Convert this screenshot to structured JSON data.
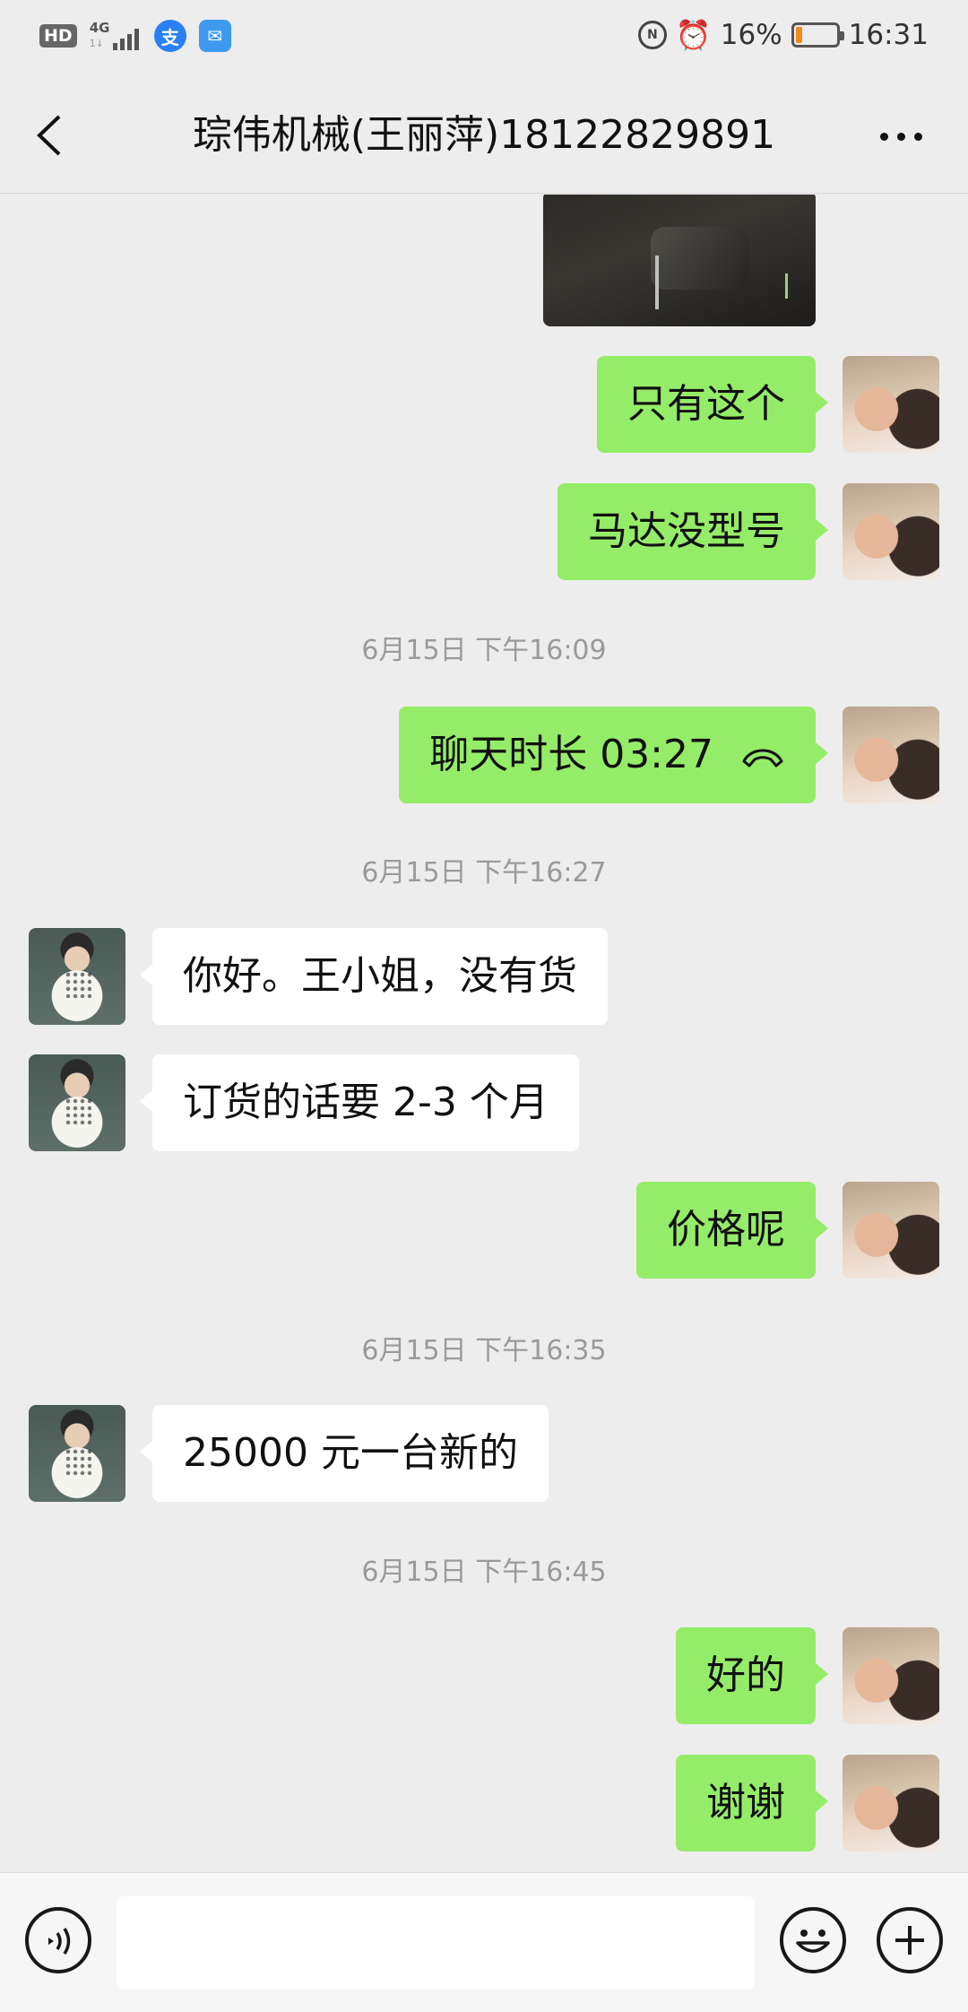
{
  "status_bar": {
    "hd": "HD",
    "network": "4G",
    "network_sub": "1↓",
    "app_icons": [
      "alipay-icon",
      "mail-icon"
    ],
    "nfc_badge": "N",
    "battery_percent": "16%",
    "battery_level": 0.16,
    "time": "16:31"
  },
  "nav": {
    "title": "琮伟机械(王丽萍)18122829891"
  },
  "messages": [
    {
      "side": "me",
      "type": "image"
    },
    {
      "side": "me",
      "type": "text",
      "text": "只有这个"
    },
    {
      "side": "me",
      "type": "text",
      "text": "马达没型号"
    },
    {
      "type": "timestamp",
      "text": "6月15日 下午16:09"
    },
    {
      "side": "me",
      "type": "call",
      "text": "聊天时长 03:27"
    },
    {
      "type": "timestamp",
      "text": "6月15日 下午16:27"
    },
    {
      "side": "other",
      "type": "text",
      "text": "你好。王小姐，没有货"
    },
    {
      "side": "other",
      "type": "text",
      "text": "订货的话要 2-3 个月"
    },
    {
      "side": "me",
      "type": "text",
      "text": "价格呢"
    },
    {
      "type": "timestamp",
      "text": "6月15日 下午16:35"
    },
    {
      "side": "other",
      "type": "text",
      "text": "25000 元一台新的"
    },
    {
      "type": "timestamp",
      "text": "6月15日 下午16:45"
    },
    {
      "side": "me",
      "type": "text",
      "text": "好的"
    },
    {
      "side": "me",
      "type": "text",
      "text": "谢谢"
    }
  ],
  "input_bar": {
    "placeholder": "",
    "value": ""
  },
  "colors": {
    "background": "#ededed",
    "my_bubble": "#95ec69",
    "their_bubble": "#ffffff",
    "battery": "#f08a1c"
  }
}
